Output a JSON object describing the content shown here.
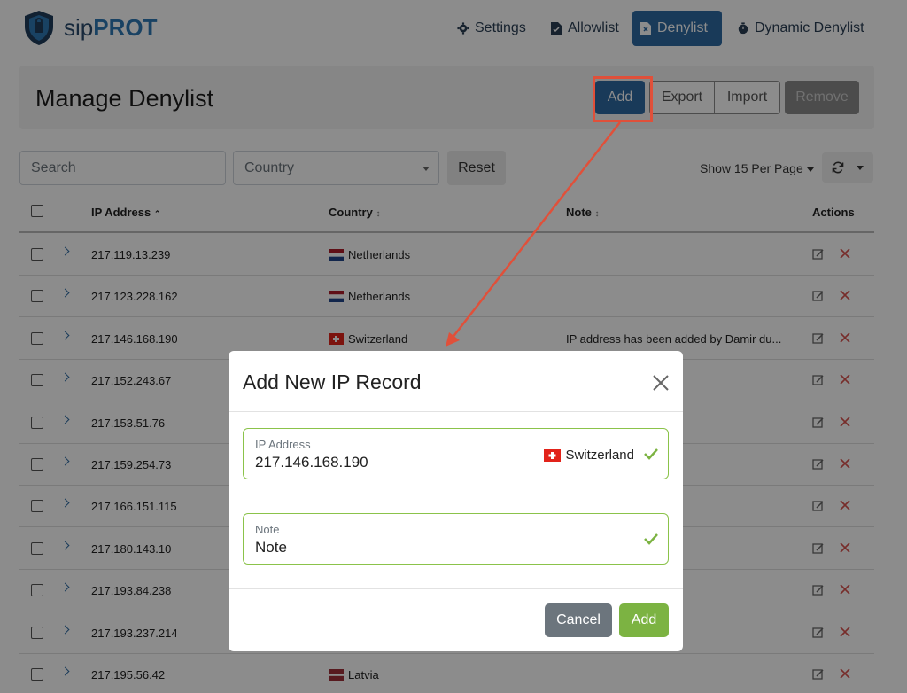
{
  "brand": {
    "sip": "sip",
    "prot": "PROT"
  },
  "nav": {
    "settings": "Settings",
    "allowlist": "Allowlist",
    "denylist": "Denylist",
    "dynamic_denylist": "Dynamic Denylist"
  },
  "header": {
    "title": "Manage Denylist",
    "add": "Add",
    "export": "Export",
    "import": "Import",
    "remove": "Remove"
  },
  "filters": {
    "search_placeholder": "Search",
    "country_placeholder": "Country",
    "reset": "Reset",
    "per_page": "Show 15 Per Page"
  },
  "table": {
    "columns": {
      "ip": "IP Address",
      "country": "Country",
      "note": "Note",
      "actions": "Actions"
    },
    "rows": [
      {
        "ip": "217.119.13.239",
        "country": "Netherlands",
        "flag": "nl",
        "note": ""
      },
      {
        "ip": "217.123.228.162",
        "country": "Netherlands",
        "flag": "nl",
        "note": ""
      },
      {
        "ip": "217.146.168.190",
        "country": "Switzerland",
        "flag": "ch",
        "note": "IP address has been added by Damir du..."
      },
      {
        "ip": "217.152.243.67",
        "country": "",
        "flag": "",
        "note": ""
      },
      {
        "ip": "217.153.51.76",
        "country": "",
        "flag": "",
        "note": ""
      },
      {
        "ip": "217.159.254.73",
        "country": "",
        "flag": "",
        "note": ""
      },
      {
        "ip": "217.166.151.115",
        "country": "",
        "flag": "",
        "note": ""
      },
      {
        "ip": "217.180.143.10",
        "country": "",
        "flag": "",
        "note": ""
      },
      {
        "ip": "217.193.84.238",
        "country": "",
        "flag": "",
        "note": ""
      },
      {
        "ip": "217.193.237.214",
        "country": "",
        "flag": "",
        "note": ""
      },
      {
        "ip": "217.195.56.42",
        "country": "Latvia",
        "flag": "lv",
        "note": ""
      }
    ]
  },
  "modal": {
    "title": "Add New IP Record",
    "ip_label": "IP Address",
    "ip_value": "217.146.168.190",
    "ip_country": "Switzerland",
    "note_label": "Note",
    "note_value": "Note",
    "cancel": "Cancel",
    "add": "Add"
  },
  "colors": {
    "primary": "#2f6aa3",
    "success": "#7cb342",
    "annotation": "#e0503a",
    "delete": "#d9534f"
  }
}
